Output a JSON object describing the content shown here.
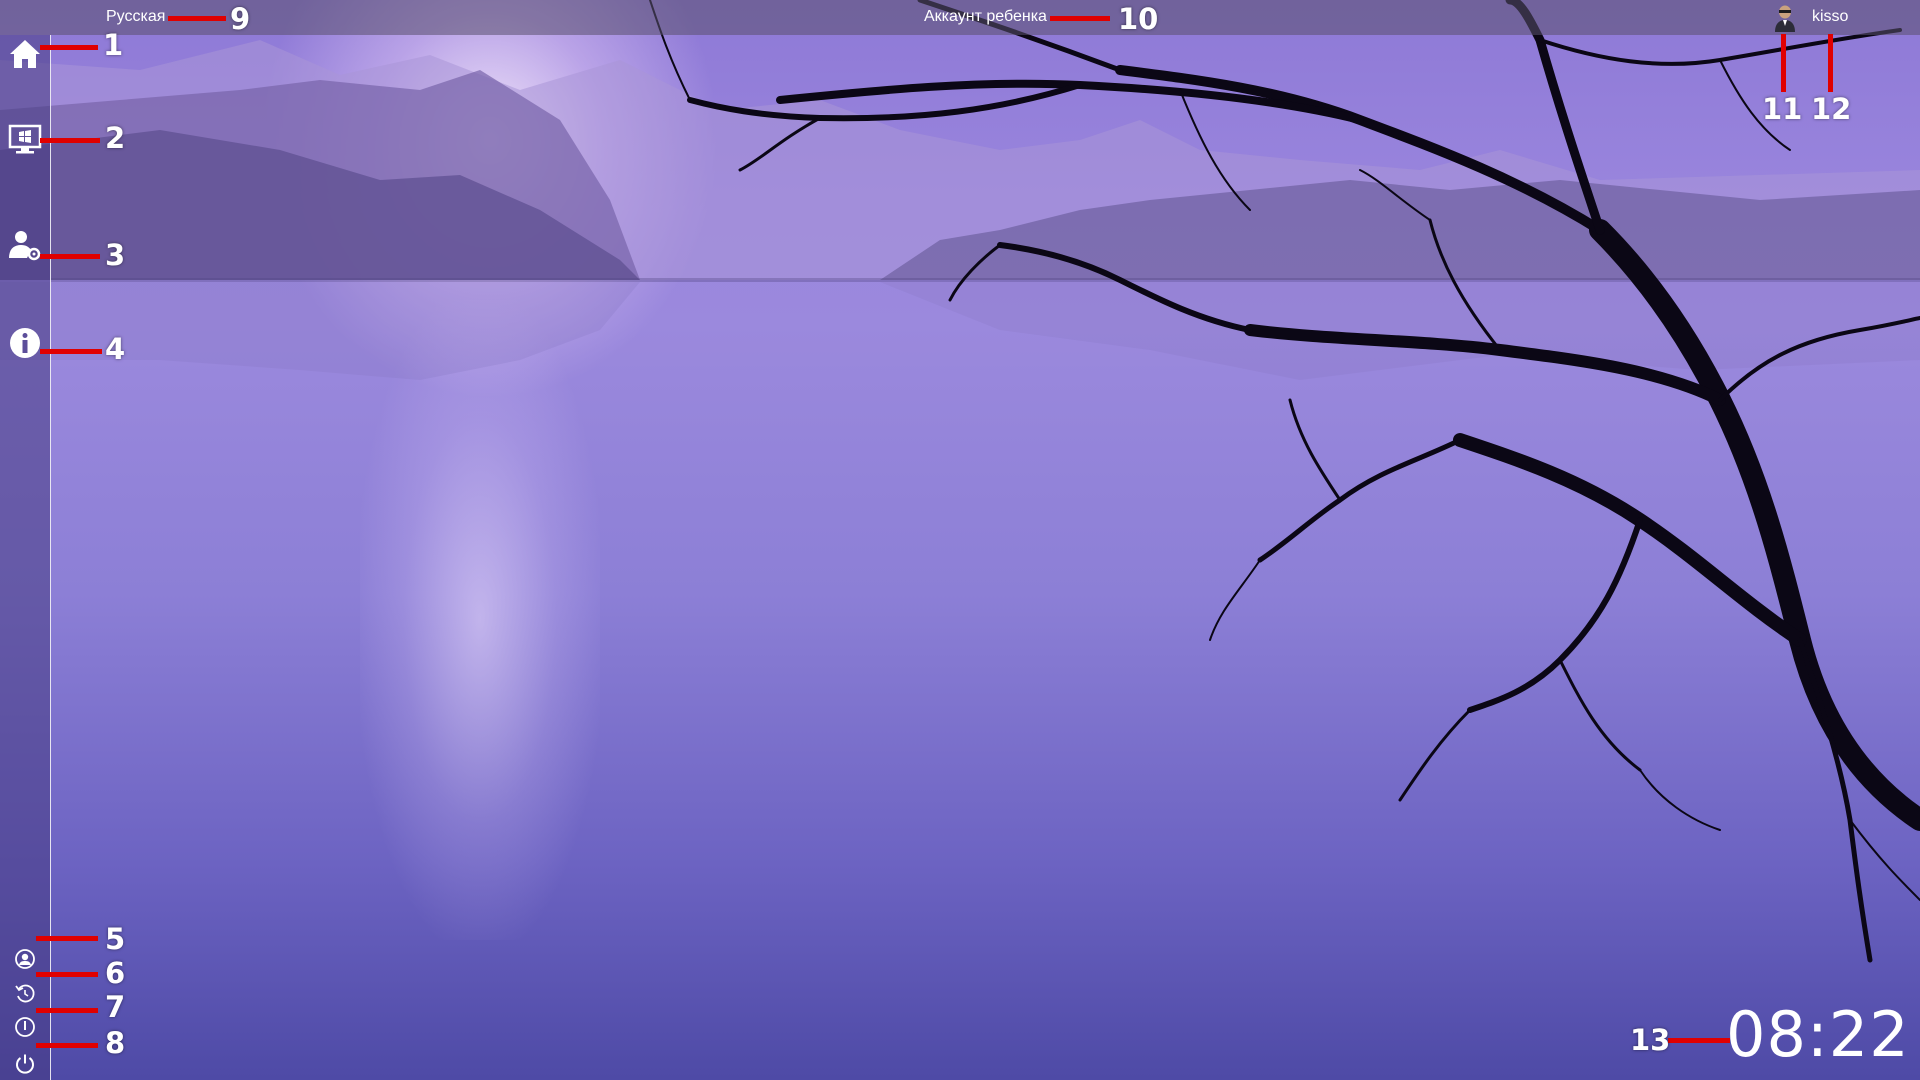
{
  "topbar": {
    "language": "Русская",
    "account_type": "Аккаунт ребенка",
    "username": "kisso",
    "avatar_icon": "user-avatar-icon"
  },
  "sidebar": {
    "top_items": [
      {
        "icon": "home-icon"
      },
      {
        "icon": "windows-monitor-icon"
      },
      {
        "icon": "user-settings-icon"
      },
      {
        "icon": "info-icon"
      }
    ],
    "bottom_items": [
      {
        "icon": "user-switch-icon"
      },
      {
        "icon": "restart-icon"
      },
      {
        "icon": "standby-icon"
      },
      {
        "icon": "power-icon"
      }
    ]
  },
  "clock": {
    "time": "08:22"
  },
  "annotations": {
    "n1": "1",
    "n2": "2",
    "n3": "3",
    "n4": "4",
    "n5": "5",
    "n6": "6",
    "n7": "7",
    "n8": "8",
    "n9": "9",
    "n10": "10",
    "n11": "11",
    "n12": "12",
    "n13": "13"
  },
  "colors": {
    "annotation_red": "#e00000",
    "wallpaper_purple": "#8c7fd6",
    "text_white": "#ffffff"
  }
}
